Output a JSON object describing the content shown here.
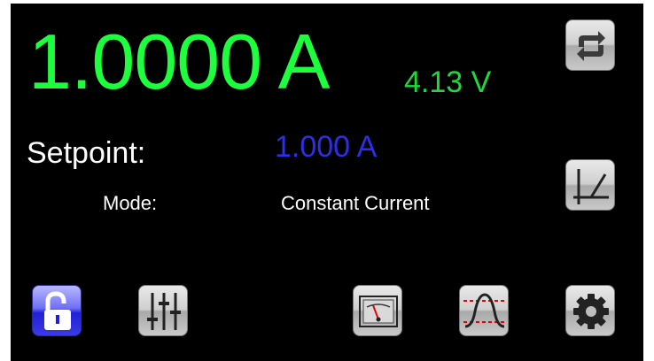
{
  "readout": {
    "current": "1.0000 A",
    "voltage": "4.13 V"
  },
  "setpoint": {
    "label": "Setpoint:",
    "value": "1.000 A"
  },
  "mode": {
    "label": "Mode:",
    "value": "Constant Current"
  },
  "colors": {
    "readout_green": "#1dff3d",
    "voltage_green": "#1dd93a",
    "setpoint_blue": "#2e2ee8",
    "background": "#000000"
  },
  "buttons": {
    "refresh": {
      "icon": "refresh-icon"
    },
    "ramp": {
      "icon": "ramp-icon"
    },
    "lock": {
      "icon": "unlock-icon"
    },
    "sliders": {
      "icon": "sliders-icon"
    },
    "meter": {
      "icon": "analog-meter-icon"
    },
    "waveform": {
      "icon": "waveform-icon"
    },
    "settings": {
      "icon": "gear-icon"
    }
  }
}
